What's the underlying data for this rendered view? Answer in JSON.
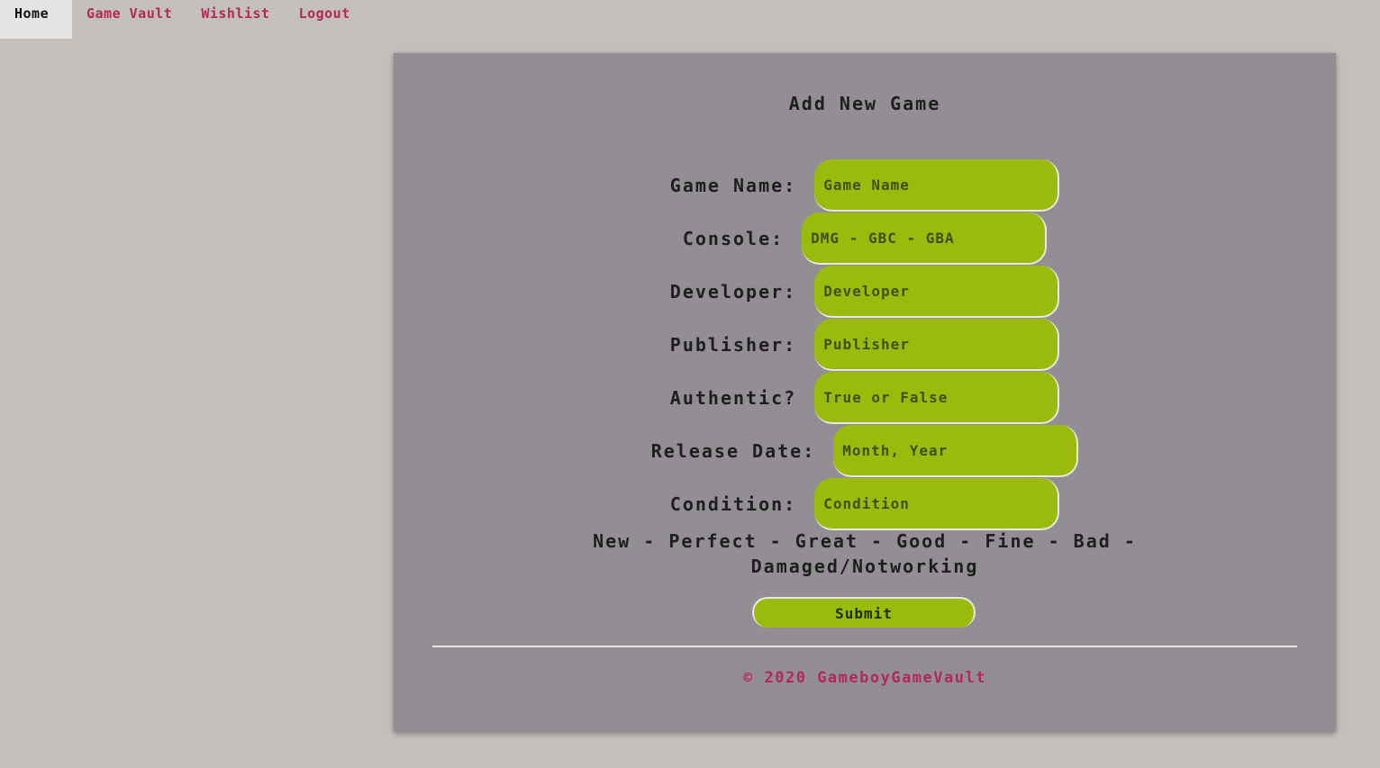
{
  "nav": {
    "items": [
      {
        "label": "Home",
        "active": true
      },
      {
        "label": "Game Vault"
      },
      {
        "label": "Wishlist"
      },
      {
        "label": "Logout"
      }
    ]
  },
  "form": {
    "title": "Add New Game",
    "fields": [
      {
        "label": "Game Name:",
        "placeholder": "Game Name"
      },
      {
        "label": "Console:",
        "placeholder": "DMG - GBC - GBA"
      },
      {
        "label": "Developer:",
        "placeholder": "Developer"
      },
      {
        "label": "Publisher:",
        "placeholder": "Publisher"
      },
      {
        "label": "Authentic?",
        "placeholder": "True or False"
      },
      {
        "label": "Release Date:",
        "placeholder": "Month, Year"
      },
      {
        "label": "Condition:",
        "placeholder": "Condition"
      }
    ],
    "condition_hint": "New - Perfect - Great - Good - Fine - Bad - Damaged/Notworking",
    "submit_label": "Submit"
  },
  "footer": {
    "text": "© 2020 GameboyGameVault"
  },
  "colors": {
    "page_bg": "#c3c0bb",
    "panel_bg": "#928e94",
    "input_bg": "#9bbb0c",
    "link": "#b3275a",
    "active_tab_bg": "#e6e5e3"
  }
}
